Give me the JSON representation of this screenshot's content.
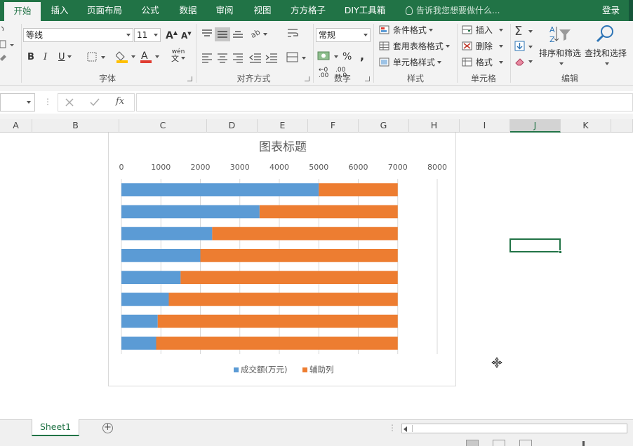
{
  "menu": {
    "tabs": [
      "开始",
      "插入",
      "页面布局",
      "公式",
      "数据",
      "审阅",
      "视图",
      "方方格子",
      "DIY工具箱"
    ],
    "active_tab": "开始",
    "tell_me": "告诉我您想要做什么...",
    "login": "登录"
  },
  "ribbon": {
    "font": {
      "name": "等线",
      "size": "11",
      "bold": "B",
      "italic": "I",
      "underline": "U",
      "phonetic": "wén",
      "label": "字体"
    },
    "alignment": {
      "label": "对齐方式"
    },
    "number": {
      "format": "常规",
      "percent": "%",
      "comma": ",",
      "label": "数字"
    },
    "styles": {
      "conditional": "条件格式",
      "table_format": "套用表格格式",
      "cell_styles": "单元格样式",
      "label": "样式"
    },
    "cells": {
      "insert": "插入",
      "delete": "删除",
      "format": "格式",
      "label": "单元格"
    },
    "editing": {
      "sort_filter": "排序和筛选",
      "find_select": "查找和选择",
      "label": "编辑"
    }
  },
  "formula_bar": {
    "fx": "fx",
    "value": ""
  },
  "columns": [
    "A",
    "B",
    "C",
    "D",
    "E",
    "F",
    "G",
    "H",
    "I",
    "J",
    "K"
  ],
  "selected_column": "J",
  "chart_data": {
    "type": "bar",
    "stacked": true,
    "title": "图表标题",
    "x_axis_position": "top",
    "xlim": [
      0,
      8000
    ],
    "x_ticks": [
      "0",
      "1000",
      "2000",
      "3000",
      "4000",
      "5000",
      "6000",
      "7000",
      "8000"
    ],
    "grid": true,
    "legend_position": "bottom",
    "series": [
      {
        "name": "成交额(万元)",
        "color": "#5b9bd5",
        "values": [
          5000,
          3500,
          2300,
          2000,
          1500,
          1200,
          920,
          880
        ]
      },
      {
        "name": "辅助列",
        "color": "#ed7d31",
        "values": [
          2000,
          3500,
          4700,
          5000,
          5500,
          5800,
          6080,
          6120
        ]
      }
    ]
  },
  "sheet_tabs": [
    "Sheet1"
  ],
  "icons": {
    "tell_me": "lightbulb-icon",
    "add_sheet": "plus-circle-icon",
    "find": "magnifier-icon",
    "sort": "sort-filter-icon",
    "sum": "sigma-icon"
  }
}
